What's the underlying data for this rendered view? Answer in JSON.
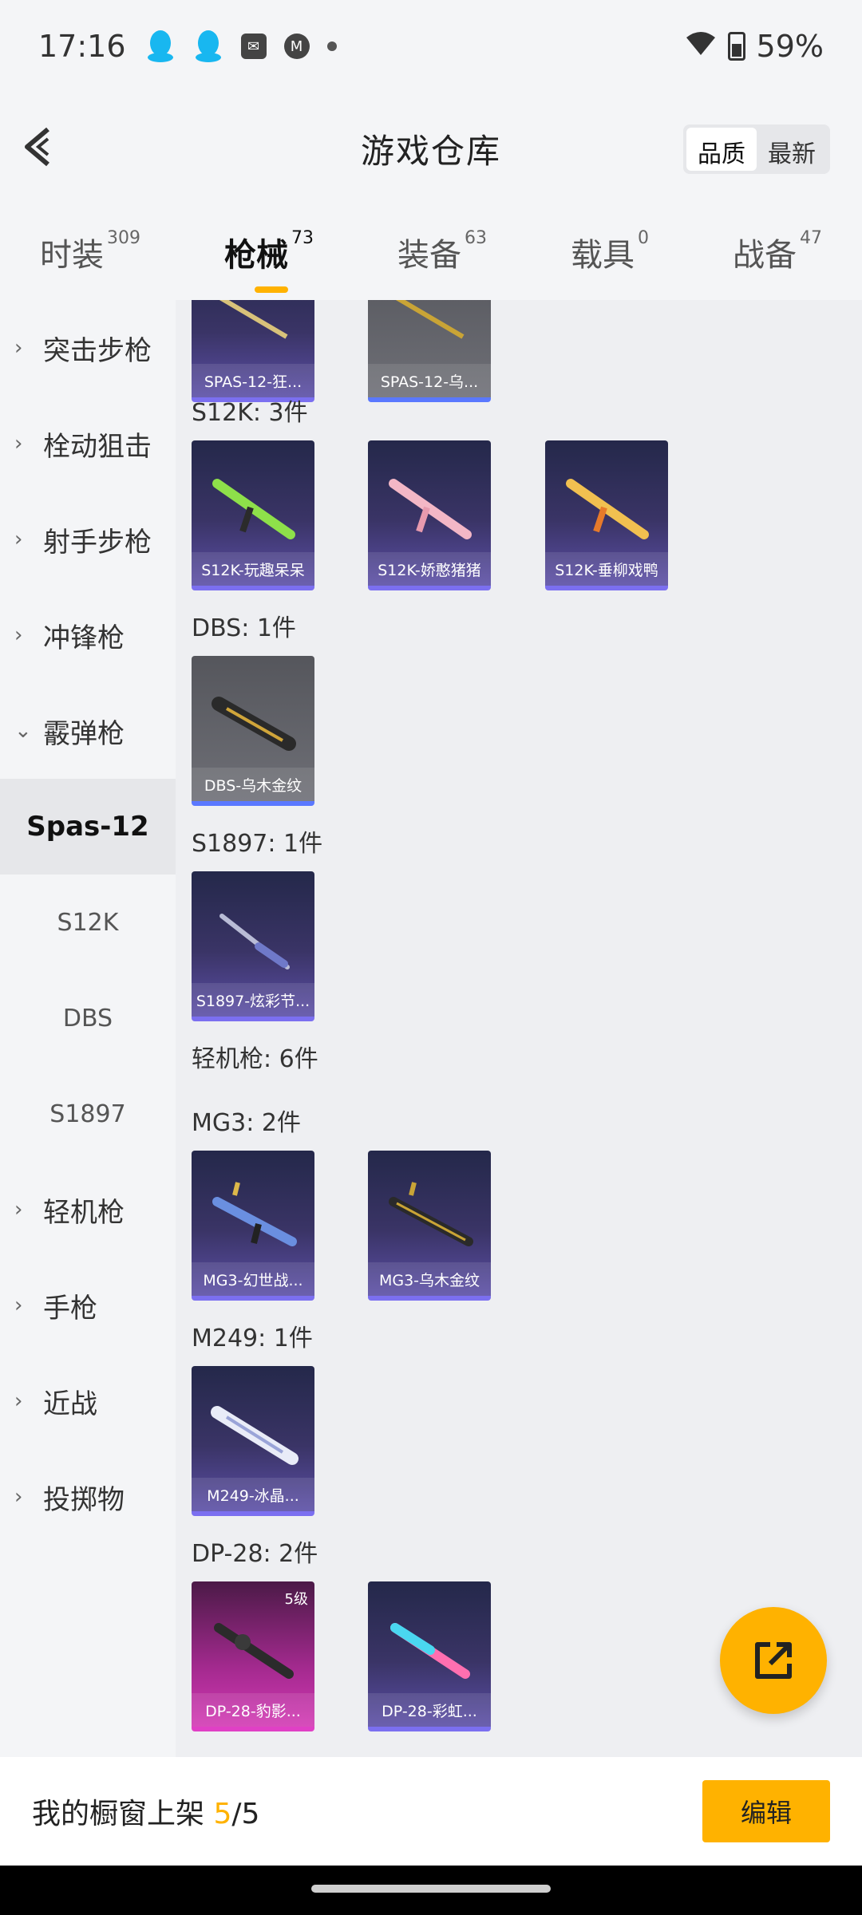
{
  "status_bar": {
    "time": "17:16",
    "battery": "59%",
    "icons": [
      "qq-icon",
      "qq-icon",
      "mail-icon",
      "motorola-icon",
      "dot-icon",
      "wifi-icon",
      "battery-icon"
    ]
  },
  "header": {
    "title": "游戏仓库",
    "sort_options": [
      "品质",
      "最新"
    ],
    "sort_selected": "品质"
  },
  "tabs": [
    {
      "label": "时装",
      "count": "309"
    },
    {
      "label": "枪械",
      "count": "73"
    },
    {
      "label": "装备",
      "count": "63"
    },
    {
      "label": "载具",
      "count": "0"
    },
    {
      "label": "战备",
      "count": "47"
    }
  ],
  "sidebar": {
    "items": [
      {
        "label": "突击步枪",
        "chev": "›"
      },
      {
        "label": "栓动狙击",
        "chev": "›"
      },
      {
        "label": "射手步枪",
        "chev": "›"
      },
      {
        "label": "冲锋枪",
        "chev": "›"
      },
      {
        "label": "霰弹枪",
        "chev": "⌄"
      },
      {
        "label": "Spas-12"
      },
      {
        "label": "S12K"
      },
      {
        "label": "DBS"
      },
      {
        "label": "S1897"
      },
      {
        "label": "轻机枪",
        "chev": "›"
      },
      {
        "label": "手枪",
        "chev": "›"
      },
      {
        "label": "近战",
        "chev": "›"
      },
      {
        "label": "投掷物",
        "chev": "›"
      }
    ]
  },
  "content": {
    "top_cards": [
      "SPAS-12-狂...",
      "SPAS-12-乌..."
    ],
    "groups": [
      {
        "title": "S12K: 3件",
        "cards": [
          "S12K-玩趣呆呆",
          "S12K-娇憨猪猪",
          "S12K-垂柳戏鸭"
        ]
      },
      {
        "title": "DBS: 1件",
        "cards": [
          "DBS-乌木金纹"
        ]
      },
      {
        "title": "S1897: 1件",
        "cards": [
          "S1897-炫彩节..."
        ]
      },
      {
        "title": "轻机枪: 6件",
        "cards": []
      },
      {
        "title": "MG3: 2件",
        "cards": [
          "MG3-幻世战...",
          "MG3-乌木金纹"
        ]
      },
      {
        "title": "M249: 1件",
        "cards": [
          "M249-冰晶..."
        ]
      },
      {
        "title": "DP-28: 2件",
        "cards": [
          "DP-28-豹影...",
          "DP-28-彩虹..."
        ],
        "level_badge": "5级"
      }
    ]
  },
  "bottom": {
    "showcase_label": "我的橱窗上架",
    "current": "5",
    "separator": "/",
    "total": "5",
    "edit_label": "编辑"
  },
  "colors": {
    "accent": "#ffb200",
    "card_purple": "#5b4ea6",
    "card_pink": "#d339b4",
    "card_gray": "#6e6f76"
  }
}
